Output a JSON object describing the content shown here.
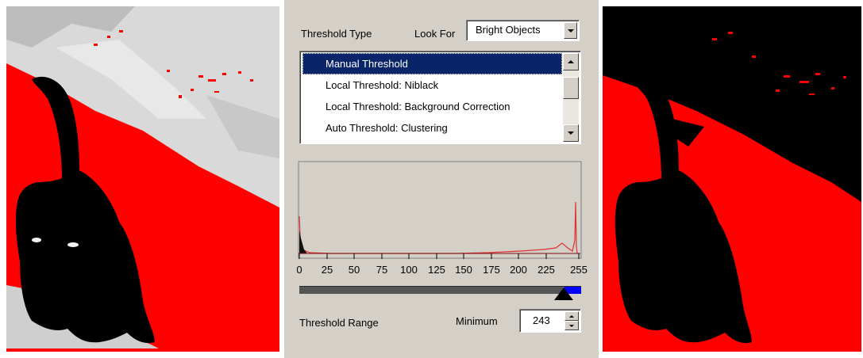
{
  "threshold_type_label": "Threshold Type",
  "look_for": {
    "label": "Look For",
    "value": "Bright Objects"
  },
  "threshold_list": {
    "items": [
      {
        "label": "Manual Threshold",
        "selected": true
      },
      {
        "label": "Local Threshold: Niblack",
        "selected": false
      },
      {
        "label": "Local Threshold: Background Correction",
        "selected": false
      },
      {
        "label": "Auto Threshold: Clustering",
        "selected": false
      }
    ]
  },
  "histogram": {
    "x_ticks": [
      "0",
      "25",
      "50",
      "75",
      "100",
      "125",
      "150",
      "175",
      "200",
      "225",
      "255"
    ],
    "line_color": "#e03030"
  },
  "range_slider": {
    "min": 0,
    "max": 255,
    "selected_from": 243,
    "selected_to": 255,
    "fill_color": "#0000ff"
  },
  "threshold_range_label": "Threshold Range",
  "minimum": {
    "label": "Minimum",
    "value": "243"
  },
  "colors": {
    "overlay_red": "#ff0000",
    "dialog_bg": "#d4d0c8",
    "selection": "#0a246a"
  }
}
